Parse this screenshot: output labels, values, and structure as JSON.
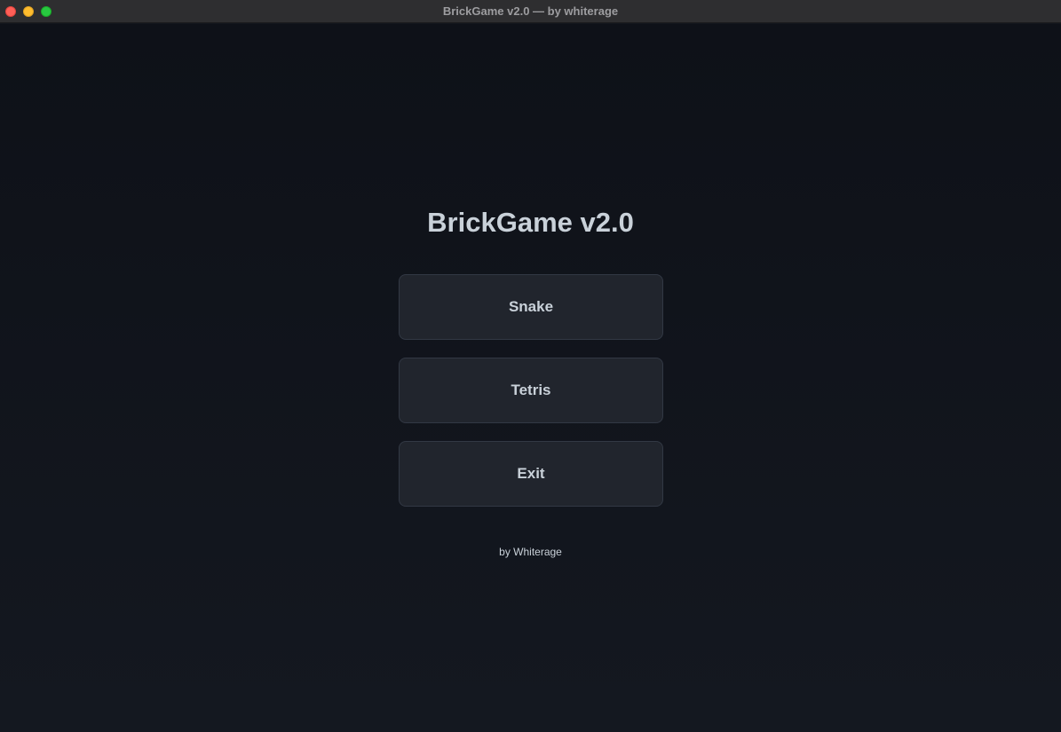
{
  "window": {
    "title": "BrickGame v2.0 — by whiterage",
    "controls": {
      "close_color": "#ff5f57",
      "minimize_color": "#febc2e",
      "maximize_color": "#28c840"
    }
  },
  "main": {
    "title": "BrickGame v2.0",
    "buttons": [
      {
        "label": "Snake"
      },
      {
        "label": "Tetris"
      },
      {
        "label": "Exit"
      }
    ],
    "footer": "by Whiterage"
  },
  "colors": {
    "background": "#13161d",
    "button_background": "#21252d",
    "text": "#c9d1d9"
  }
}
